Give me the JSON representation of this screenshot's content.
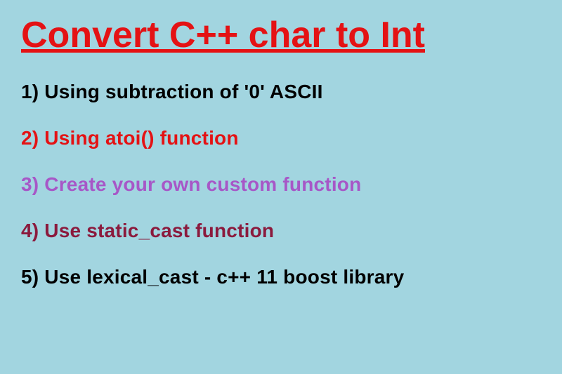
{
  "title": "Convert C++ char to Int",
  "items": [
    {
      "text": "1) Using subtraction of '0' ASCII",
      "colorClass": "color-black"
    },
    {
      "text": "2) Using atoi() function",
      "colorClass": "color-red"
    },
    {
      "text": "3) Create your own custom function",
      "colorClass": "color-purple"
    },
    {
      "text": "4) Use static_cast function",
      "colorClass": "color-maroon"
    },
    {
      "text": "5) Use lexical_cast - c++ 11 boost library",
      "colorClass": "color-black"
    }
  ]
}
